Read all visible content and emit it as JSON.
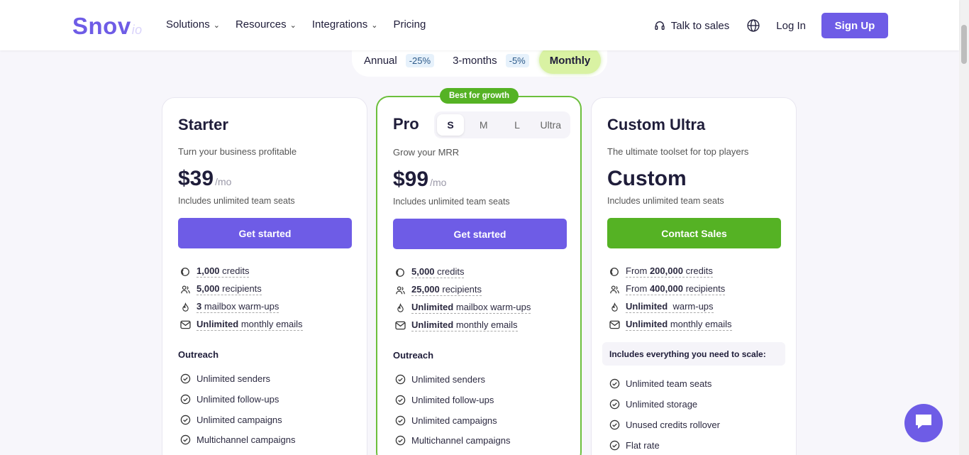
{
  "header": {
    "logo": "Snov",
    "logo_suffix": "io",
    "nav": [
      {
        "label": "Solutions",
        "dropdown": true
      },
      {
        "label": "Resources",
        "dropdown": true
      },
      {
        "label": "Integrations",
        "dropdown": true
      },
      {
        "label": "Pricing",
        "dropdown": false
      }
    ],
    "talk_to_sales": "Talk to sales",
    "login": "Log In",
    "signup": "Sign Up"
  },
  "billing": {
    "annual": "Annual",
    "annual_discount": "-25%",
    "three_months": "3-months",
    "three_months_discount": "-5%",
    "monthly": "Monthly"
  },
  "badge": "Best for growth",
  "plans": {
    "starter": {
      "title": "Starter",
      "subtitle": "Turn your business profitable",
      "price": "$39",
      "per": "/mo",
      "seats": "Includes unlimited team seats",
      "cta": "Get started",
      "features": [
        {
          "bold": "1,000",
          "rest": " credits"
        },
        {
          "bold": "5,000",
          "rest": " recipients"
        },
        {
          "bold": "3",
          "rest": " mailbox warm-ups"
        },
        {
          "bold": "Unlimited",
          "rest": " monthly emails"
        }
      ],
      "section": "Outreach",
      "checks": [
        "Unlimited senders",
        "Unlimited follow-ups",
        "Unlimited campaigns",
        "Multichannel campaigns"
      ]
    },
    "pro": {
      "title": "Pro",
      "sizes": [
        "S",
        "M",
        "L",
        "Ultra"
      ],
      "active_size": "S",
      "subtitle": "Grow your MRR",
      "price": "$99",
      "per": "/mo",
      "seats": "Includes unlimited team seats",
      "cta": "Get started",
      "features": [
        {
          "bold": "5,000",
          "rest": " credits"
        },
        {
          "bold": "25,000",
          "rest": " recipients"
        },
        {
          "bold": "Unlimited",
          "rest": " mailbox warm-ups"
        },
        {
          "bold": "Unlimited",
          "rest": " monthly emails"
        }
      ],
      "section": "Outreach",
      "checks": [
        "Unlimited senders",
        "Unlimited follow-ups",
        "Unlimited campaigns",
        "Multichannel campaigns"
      ]
    },
    "custom": {
      "title": "Custom Ultra",
      "subtitle": "The ultimate toolset for top players",
      "price": "Custom",
      "seats": "Includes unlimited team seats",
      "cta": "Contact Sales",
      "features": [
        {
          "pre": "From ",
          "bold": "200,000",
          "rest": " credits"
        },
        {
          "pre": "From ",
          "bold": "400,000",
          "rest": " recipients"
        },
        {
          "bold": "Unlimited",
          "rest": "  warm-ups"
        },
        {
          "bold": "Unlimited",
          "rest": " monthly emails"
        }
      ],
      "section": "Includes everything you need to scale:",
      "checks": [
        "Unlimited team seats",
        "Unlimited storage",
        "Unused credits rollover",
        "Flat rate"
      ]
    }
  },
  "colors": {
    "brand": "#6e5ce6",
    "green": "#55b224",
    "monthly_bg": "#d9f2a3"
  }
}
